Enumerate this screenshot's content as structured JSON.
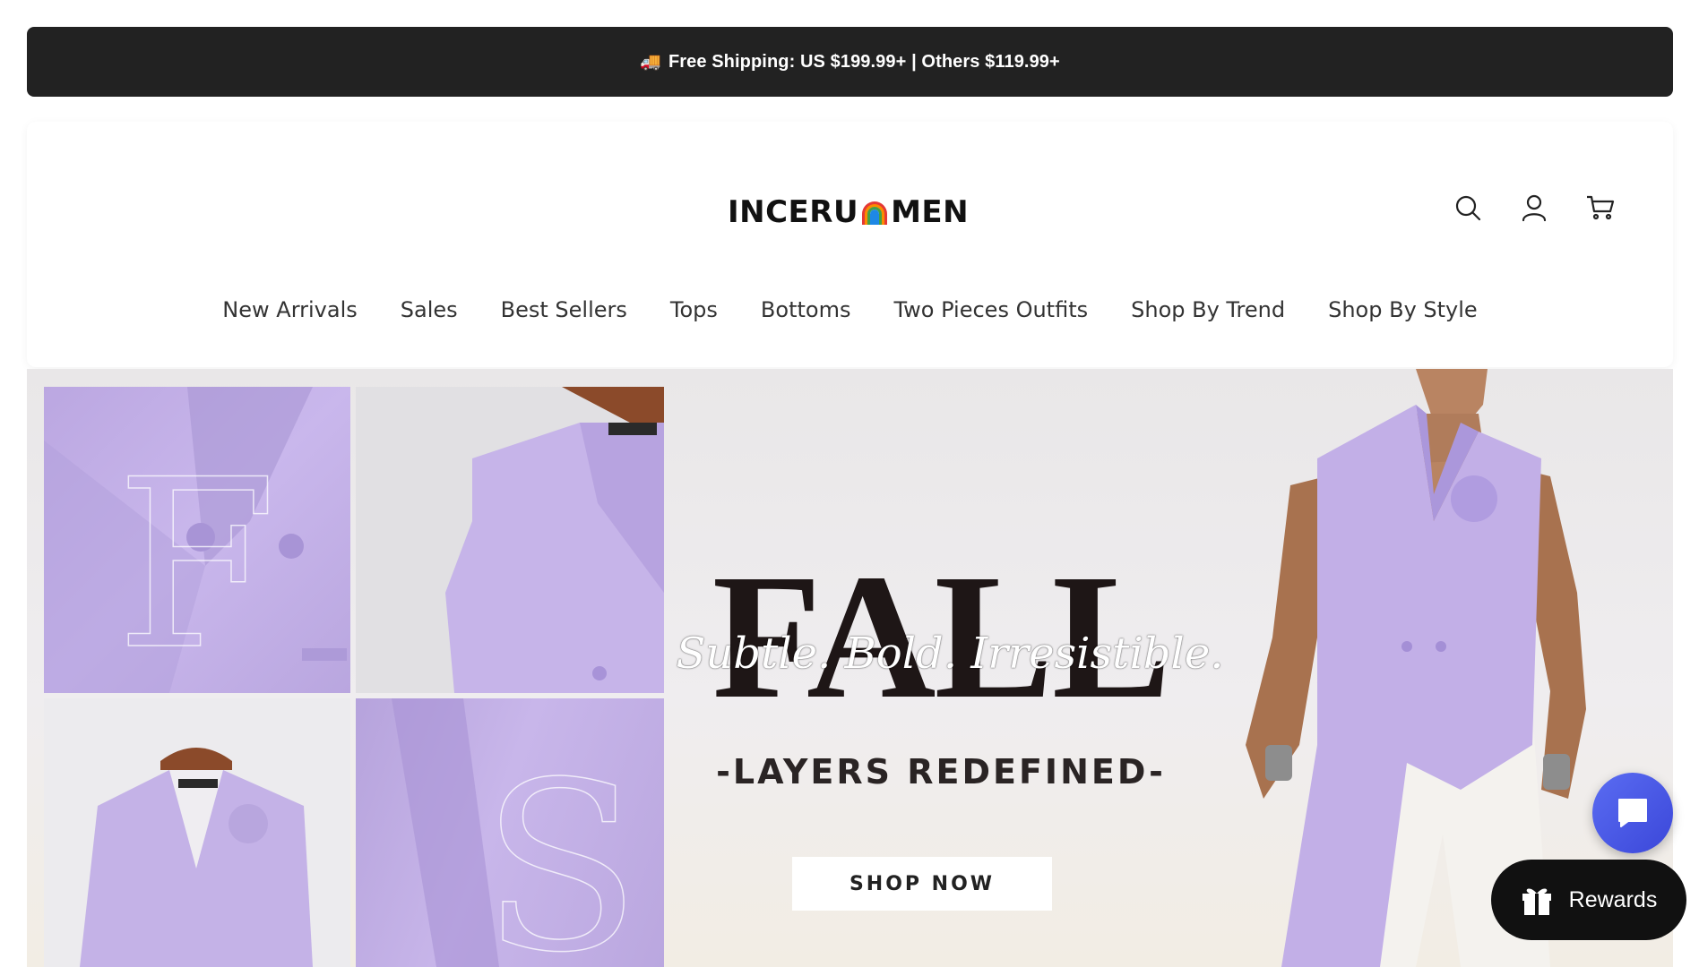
{
  "announcement": {
    "icon": "truck-icon",
    "text": "Free Shipping: US $199.99+ | Others $119.99+"
  },
  "header": {
    "logo_left": "INCERU",
    "logo_right": "MEN",
    "icons": [
      "search-icon",
      "account-icon",
      "cart-icon"
    ]
  },
  "nav": {
    "items": [
      {
        "label": "New Arrivals"
      },
      {
        "label": "Sales"
      },
      {
        "label": "Best Sellers"
      },
      {
        "label": "Tops"
      },
      {
        "label": "Bottoms"
      },
      {
        "label": "Two Pieces Outfits"
      },
      {
        "label": "Shop By Trend"
      },
      {
        "label": "Shop By Style"
      }
    ]
  },
  "hero": {
    "headline": "FALL",
    "script_line": "Subtle. Bold. Irresistible.",
    "subheading": "-LAYERS REDEFINED-",
    "cta": "SHOP NOW",
    "accent_color": "#c4b2e6"
  },
  "widgets": {
    "chat_icon": "chat-bubble-icon",
    "rewards_icon": "gift-icon",
    "rewards_label": "Rewards",
    "chat_color": "#4a57e6"
  }
}
